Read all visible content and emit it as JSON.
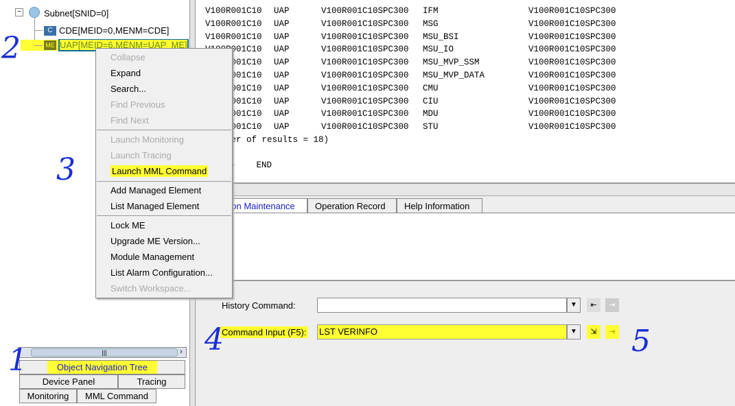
{
  "tree": {
    "subnet": "Subnet[SNID=0]",
    "cde": "CDE[MEID=0,MENM=CDE]",
    "uap": "UAP[MEID=6,MENM=UAP_ME]",
    "cde_icon": "C",
    "uap_icon": "ME"
  },
  "output": {
    "rows": [
      [
        "V100R001C10",
        "UAP",
        "V100R001C10SPC300",
        "IFM",
        "V100R001C10SPC300"
      ],
      [
        "V100R001C10",
        "UAP",
        "V100R001C10SPC300",
        "MSG",
        "V100R001C10SPC300"
      ],
      [
        "V100R001C10",
        "UAP",
        "V100R001C10SPC300",
        "MSU_BSI",
        "V100R001C10SPC300"
      ],
      [
        "V100R001C10",
        "UAP",
        "V100R001C10SPC300",
        "MSU_IO",
        "V100R001C10SPC300"
      ],
      [
        "V100R001C10",
        "UAP",
        "V100R001C10SPC300",
        "MSU_MVP_SSM",
        "V100R001C10SPC300"
      ],
      [
        "V100R001C10",
        "UAP",
        "V100R001C10SPC300",
        "MSU_MVP_DATA",
        "V100R001C10SPC300"
      ],
      [
        "V100R001C10",
        "UAP",
        "V100R001C10SPC300",
        "CMU",
        "V100R001C10SPC300"
      ],
      [
        "V100R001C10",
        "UAP",
        "V100R001C10SPC300",
        "CIU",
        "V100R001C10SPC300"
      ],
      [
        "V100R001C10",
        "UAP",
        "V100R001C10SPC300",
        "MDU",
        "V100R001C10SPC300"
      ],
      [
        "V100R001C10",
        "UAP",
        "V100R001C10SPC300",
        "STU",
        "V100R001C10SPC300"
      ]
    ],
    "summary": "(Number of results = 18)",
    "end": "---    END"
  },
  "tabs": [
    "Common Maintenance",
    "Operation Record",
    "Help Information"
  ],
  "menu": {
    "items": [
      "Collapse",
      "Expand",
      "Search...",
      "Find Previous",
      "Find Next",
      "Launch Monitoring",
      "Launch Tracing",
      "Launch MML Command",
      "Add Managed Element",
      "List Managed Element",
      "Lock ME",
      "Upgrade ME Version...",
      "Module Management",
      "List Alarm Configuration...",
      "Switch Workspace..."
    ]
  },
  "command": {
    "history_label": "History Command:",
    "history_value": "",
    "input_label": "Command Input (F5):",
    "input_value": "LST VERINFO"
  },
  "left_tabs": [
    "Object Navigation Tree",
    "Device Panel",
    "Tracing",
    "Monitoring",
    "MML Command"
  ],
  "annotations": [
    "1",
    "2",
    "3",
    "4",
    "5"
  ],
  "colors": {
    "highlight": "#ffff33",
    "selection": "#0a6b9e",
    "annotation": "#1a2fd6",
    "active_tab_text": "#1a1acc"
  }
}
